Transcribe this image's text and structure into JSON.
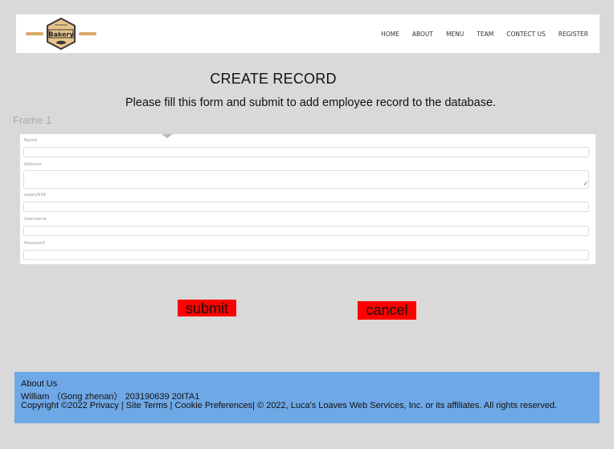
{
  "nav": {
    "logo_text": "Bakery",
    "links": [
      "HOME",
      "ABOUT",
      "MENU",
      "TEAM",
      "CONTECT US",
      "REGISTER"
    ]
  },
  "heading": {
    "title": "CREATE RECORD",
    "subtitle": "Please fill this form and submit to add employee record to the database."
  },
  "frame_label": "Frame 1",
  "form": {
    "name_label": "Name",
    "name_value": "",
    "address_label": "Address",
    "address_value": "",
    "salary_label": "salary839",
    "salary_value": "",
    "username_label": "Username",
    "username_value": "",
    "password_label": "Password",
    "password_value": ""
  },
  "buttons": {
    "submit": "submit",
    "cancel": "cancel"
  },
  "footer": {
    "about": "About Us",
    "author": "William （Gong zhenan） 203190639 20ITA1",
    "copyright": "Copyright ©2022 Privacy | Site Terms | Cookie Preferences| © 2022, Luca's Loaves Web Services, Inc. or its affiliates. All rights reserved."
  },
  "colors": {
    "background": "#d9d9d9",
    "button": "#ff0000",
    "footer": "#6fa8e6",
    "logo_fill": "#e8c48a",
    "logo_stroke": "#3a3a3a"
  }
}
